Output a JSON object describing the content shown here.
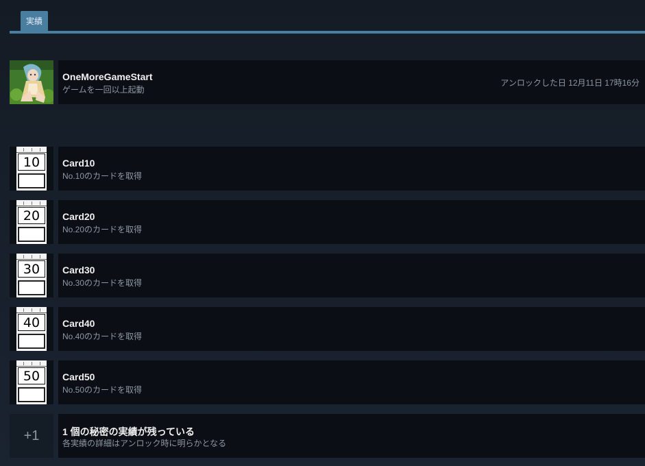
{
  "tabs": {
    "active_label": "実績"
  },
  "achievements_unlocked": [
    {
      "name": "OneMoreGameStart",
      "description": "ゲームを一回以上起動",
      "unlock_text": "アンロックした日 12月11日 17時16分"
    }
  ],
  "achievements_locked": [
    {
      "icon_number": "10",
      "name": "Card10",
      "description": "No.10のカードを取得"
    },
    {
      "icon_number": "20",
      "name": "Card20",
      "description": "No.20のカードを取得"
    },
    {
      "icon_number": "30",
      "name": "Card30",
      "description": "No.30のカードを取得"
    },
    {
      "icon_number": "40",
      "name": "Card40",
      "description": "No.40のカードを取得"
    },
    {
      "icon_number": "50",
      "name": "Card50",
      "description": "No.50のカードを取得"
    }
  ],
  "hidden": {
    "count_badge": "+1",
    "title": "1 個の秘密の実績が残っている",
    "description": "各実績の詳細はアンロック時に明らかとなる"
  }
}
